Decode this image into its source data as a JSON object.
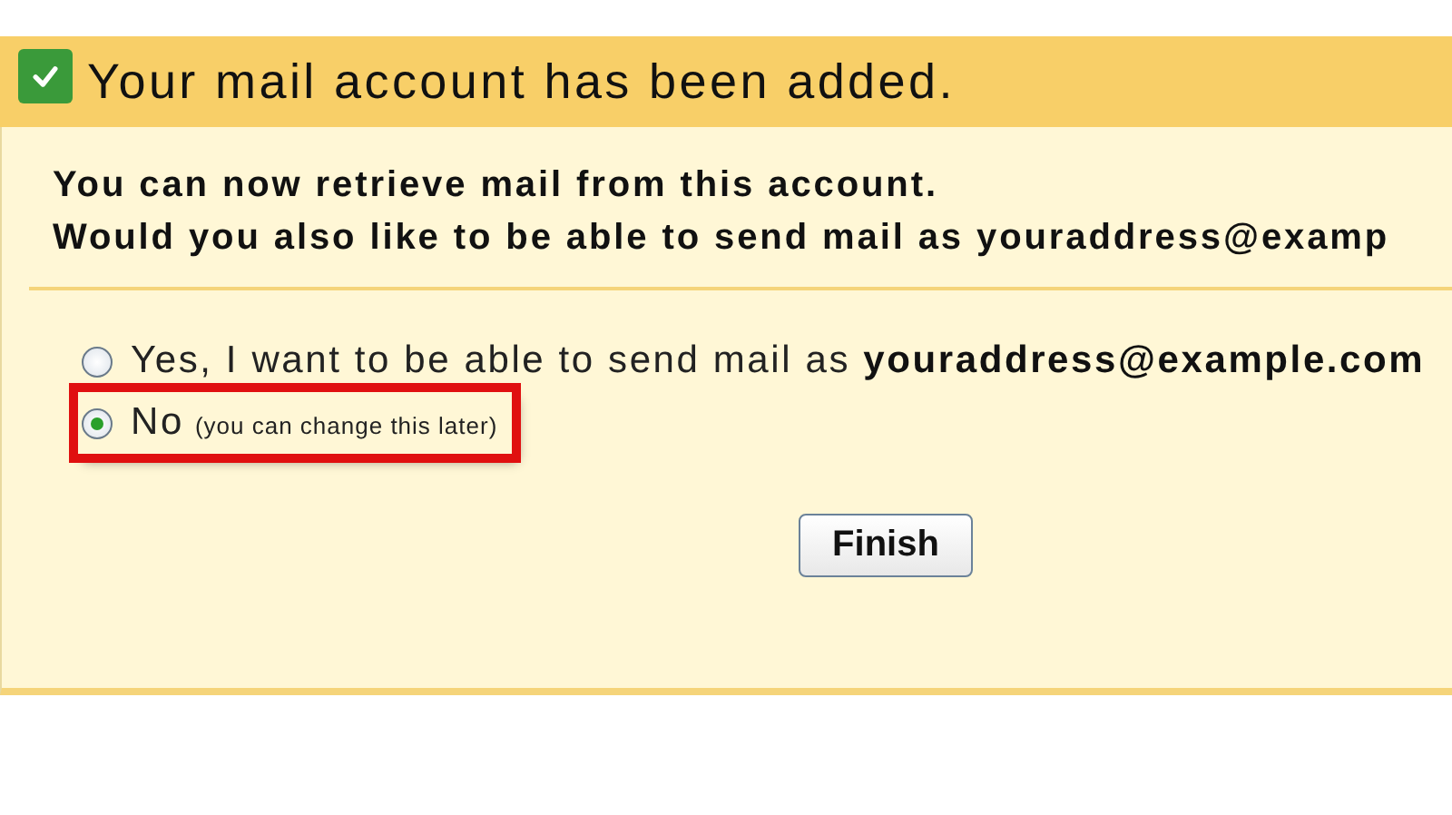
{
  "header": {
    "checked": true,
    "title": "Your mail account has been added."
  },
  "message": [
    "You can now retrieve mail from this account.",
    "Would you also like to be able to send mail as youraddress@examp"
  ],
  "options": [
    {
      "label": "Yes, I want to be able to send mail as **youraddress@example.com**",
      "selected": false
    },
    {
      "label": "No",
      "hint": "(you can change this later)",
      "selected": true,
      "highlighted": true
    }
  ],
  "buttons": [
    "Finish"
  ]
}
